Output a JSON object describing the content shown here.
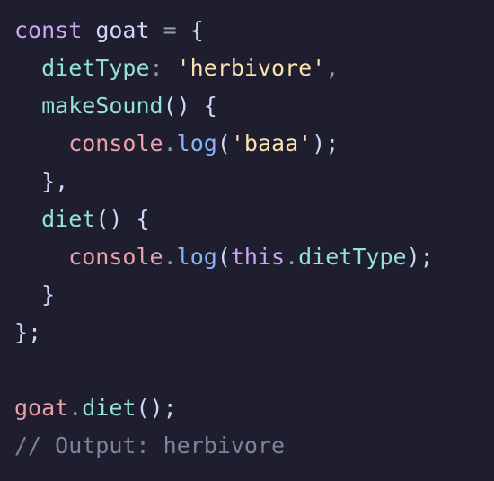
{
  "colors": {
    "background": "#1e1e2e",
    "text": "#cdd6f4",
    "keyword": "#cba6f7",
    "variable": "#cdd6f4",
    "property": "#94e2d5",
    "string": "#f9e2af",
    "function": "#89b4fa",
    "builtin": "#eba0ac",
    "punctuation": "#9399b2",
    "comment": "#7f849c"
  },
  "code": {
    "lines": [
      [
        {
          "text": "const",
          "type": "keyword"
        },
        {
          "text": " goat ",
          "type": "variable"
        },
        {
          "text": "=",
          "type": "punctuation"
        },
        {
          "text": " {",
          "type": "text"
        }
      ],
      [
        {
          "text": "  dietType",
          "type": "property"
        },
        {
          "text": ": ",
          "type": "punctuation"
        },
        {
          "text": "'herbivore'",
          "type": "string"
        },
        {
          "text": ",",
          "type": "punctuation"
        }
      ],
      [
        {
          "text": "  makeSound",
          "type": "property"
        },
        {
          "text": "() {",
          "type": "text"
        }
      ],
      [
        {
          "text": "    console",
          "type": "builtin"
        },
        {
          "text": ".",
          "type": "punctuation"
        },
        {
          "text": "log",
          "type": "function"
        },
        {
          "text": "(",
          "type": "text"
        },
        {
          "text": "'baaa'",
          "type": "string"
        },
        {
          "text": ");",
          "type": "text"
        }
      ],
      [
        {
          "text": "  },",
          "type": "text"
        }
      ],
      [
        {
          "text": "  diet",
          "type": "property"
        },
        {
          "text": "() {",
          "type": "text"
        }
      ],
      [
        {
          "text": "    console",
          "type": "builtin"
        },
        {
          "text": ".",
          "type": "punctuation"
        },
        {
          "text": "log",
          "type": "function"
        },
        {
          "text": "(",
          "type": "text"
        },
        {
          "text": "this",
          "type": "keyword"
        },
        {
          "text": ".",
          "type": "punctuation"
        },
        {
          "text": "dietType",
          "type": "property"
        },
        {
          "text": ");",
          "type": "text"
        }
      ],
      [
        {
          "text": "  }",
          "type": "text"
        }
      ],
      [
        {
          "text": "};",
          "type": "text"
        }
      ],
      [],
      [
        {
          "text": "goat",
          "type": "builtin"
        },
        {
          "text": ".",
          "type": "punctuation"
        },
        {
          "text": "diet",
          "type": "property"
        },
        {
          "text": "();",
          "type": "text"
        }
      ],
      [
        {
          "text": "// Output: herbivore",
          "type": "comment"
        }
      ]
    ]
  }
}
